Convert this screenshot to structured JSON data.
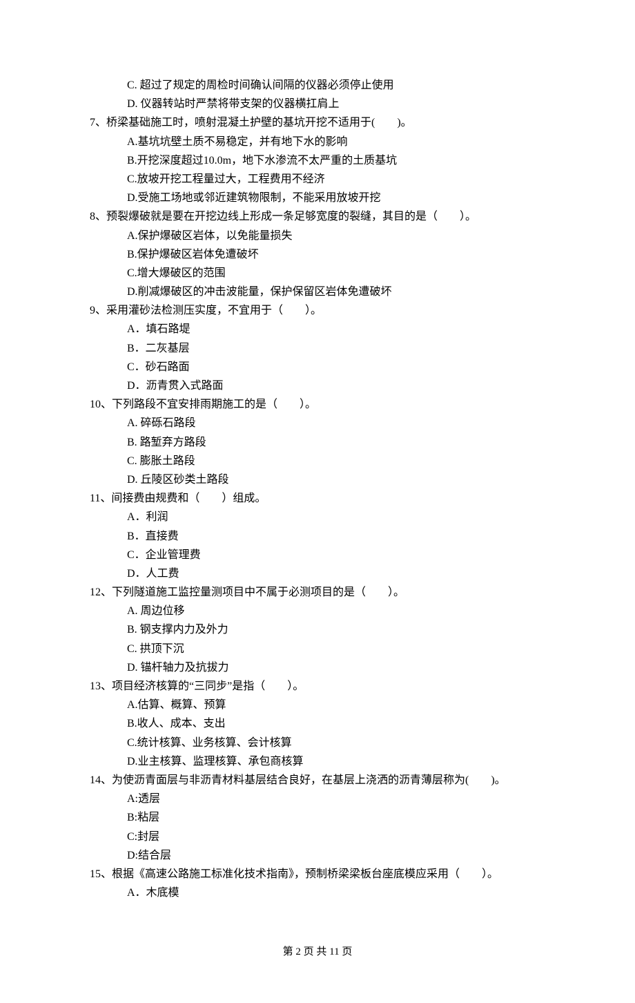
{
  "pre_options": [
    "C. 超过了规定的周检时间确认间隔的仪器必须停止使用",
    "D. 仪器转站时严禁将带支架的仪器横扛肩上"
  ],
  "questions": [
    {
      "stem": "7、桥梁基础施工时，喷射混凝土护壁的基坑开挖不适用于(　　)。",
      "options": [
        "A.基坑坑壁土质不易稳定，并有地下水的影响",
        "B.开挖深度超过10.0m，地下水渗流不太严重的土质基坑",
        "C.放坡开挖工程量过大，工程费用不经济",
        "D.受施工场地或邻近建筑物限制，不能采用放坡开挖"
      ]
    },
    {
      "stem": "8、预裂爆破就是要在开挖边线上形成一条足够宽度的裂缝，其目的是（　　）。",
      "options": [
        "A.保护爆破区岩体，以免能量损失",
        "B.保护爆破区岩体免遭破坏",
        "C.增大爆破区的范围",
        "D.削减爆破区的冲击波能量，保护保留区岩体免遭破坏"
      ]
    },
    {
      "stem": "9、采用灌砂法检测压实度，不宜用于（　　）。",
      "options": [
        "A．填石路堤",
        "B．二灰基层",
        "C．砂石路面",
        "D．沥青贯入式路面"
      ]
    },
    {
      "stem": "10、下列路段不宜安排雨期施工的是（　　）。",
      "options": [
        "A. 碎砾石路段",
        "B. 路堑弃方路段",
        "C. 膨胀土路段",
        "D. 丘陵区砂类土路段"
      ]
    },
    {
      "stem": "11、间接费由规费和（　　）组成。",
      "options": [
        "A．利润",
        "B．直接费",
        "C．企业管理费",
        "D．人工费"
      ]
    },
    {
      "stem": "12、下列隧道施工监控量测项目中不属于必测项目的是（　　）。",
      "options": [
        "A. 周边位移",
        "B. 钢支撑内力及外力",
        "C. 拱顶下沉",
        "D. 锚杆轴力及抗拔力"
      ]
    },
    {
      "stem": "13、项目经济核算的“三同步”是指（　　）。",
      "options": [
        "A.估算、概算、预算",
        "B.收人、成本、支出",
        "C.统计核算、业务核算、会计核算",
        "D.业主核算、监理核算、承包商核算"
      ]
    },
    {
      "stem": "14、为使沥青面层与非沥青材料基层结合良好，在基层上浇洒的沥青薄层称为(　　)。",
      "options": [
        "A:透层",
        "B:粘层",
        "C:封层",
        "D:结合层"
      ]
    },
    {
      "stem": "15、根据《高速公路施工标准化技术指南》，预制桥梁梁板台座底模应采用（　　）。",
      "options": [
        "A．木底模"
      ]
    }
  ],
  "footer": "第 2 页 共 11 页"
}
